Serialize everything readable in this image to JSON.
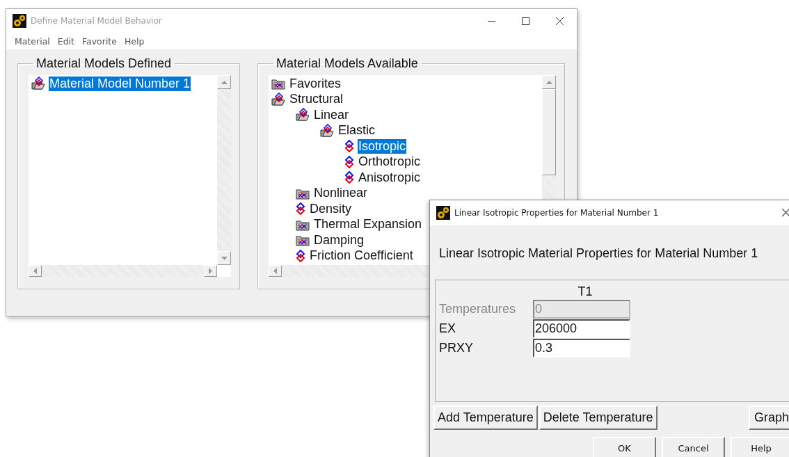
{
  "main_window": {
    "title": "Define Material Model Behavior",
    "menu": [
      "Material",
      "Edit",
      "Favorite",
      "Help"
    ],
    "defined_group": {
      "title": "Material Models Defined",
      "items": [
        {
          "label": "Material Model Number 1",
          "kind": "folder",
          "expanded": true,
          "selected": true
        }
      ]
    },
    "available_group": {
      "title": "Material Models Available",
      "tree": [
        {
          "label": "Favorites",
          "kind": "folder",
          "expanded": false,
          "selected": false
        },
        {
          "label": "Structural",
          "kind": "folder",
          "expanded": true,
          "selected": false,
          "children": [
            {
              "label": "Linear",
              "kind": "folder",
              "expanded": true,
              "selected": false,
              "children": [
                {
                  "label": "Elastic",
                  "kind": "folder",
                  "expanded": true,
                  "selected": false,
                  "children": [
                    {
                      "label": "Isotropic",
                      "kind": "model",
                      "selected": true
                    },
                    {
                      "label": "Orthotropic",
                      "kind": "model",
                      "selected": false
                    },
                    {
                      "label": "Anisotropic",
                      "kind": "model",
                      "selected": false
                    }
                  ]
                }
              ]
            },
            {
              "label": "Nonlinear",
              "kind": "folder",
              "expanded": false,
              "selected": false
            },
            {
              "label": "Density",
              "kind": "model",
              "selected": false
            },
            {
              "label": "Thermal Expansion",
              "kind": "folder",
              "expanded": false,
              "selected": false
            },
            {
              "label": "Damping",
              "kind": "folder",
              "expanded": false,
              "selected": false
            },
            {
              "label": "Friction Coefficient",
              "kind": "model",
              "selected": false
            }
          ]
        }
      ]
    }
  },
  "dialog": {
    "title": "Linear Isotropic Properties for Material Number 1",
    "heading": "Linear Isotropic Material Properties for Material Number 1",
    "table": {
      "column": "T1",
      "rows": [
        {
          "label": "Temperatures",
          "value": "0",
          "disabled": true
        },
        {
          "label": "EX",
          "value": "206000",
          "disabled": false
        },
        {
          "label": "PRXY",
          "value": "0.3",
          "disabled": false
        }
      ]
    },
    "buttons": [
      "Add Temperature",
      "Delete Temperature",
      "Graph"
    ],
    "footer_buttons": [
      "OK",
      "Cancel",
      "Help"
    ]
  }
}
